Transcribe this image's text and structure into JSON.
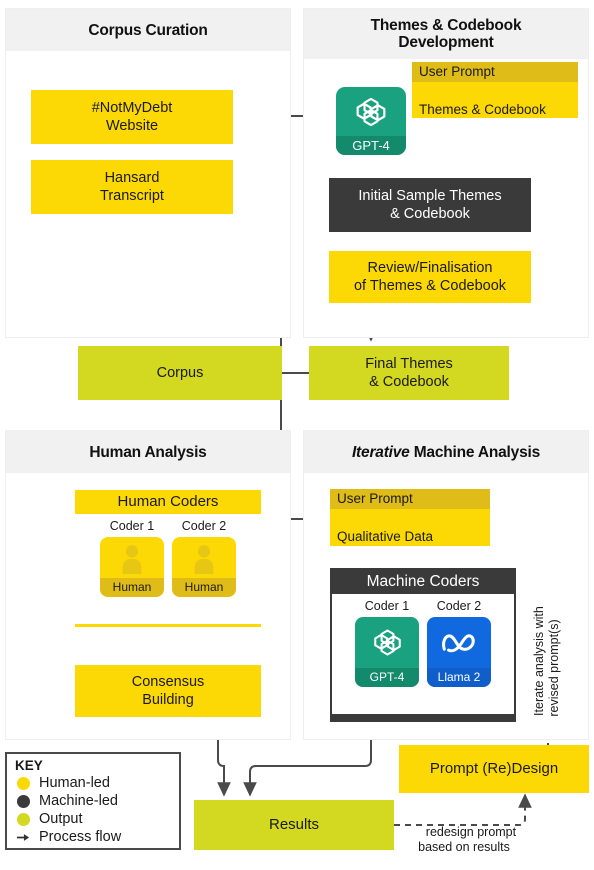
{
  "panels": {
    "corpus_curation": {
      "title": "Corpus Curation"
    },
    "themes": {
      "title_line1": "Themes & Codebook",
      "title_line2": "Development"
    },
    "human_analysis": {
      "title": "Human Analysis"
    },
    "machine_analysis": {
      "title_italic": "Iterative",
      "title_rest": " Machine Analysis"
    }
  },
  "nodes": {
    "notmydebt": "#NotMyDebt\nWebsite",
    "hansard": "Hansard\nTranscript",
    "corpus": "Corpus",
    "initial_sample": "Initial Sample Themes\n& Codebook",
    "review_final": "Review/Finalisation\nof Themes & Codebook",
    "final_themes": "Final Themes\n& Codebook",
    "consensus": "Consensus\nBuilding",
    "results": "Results",
    "prompt_redesign": "Prompt (Re)Design"
  },
  "prompts": {
    "themes_prompt": {
      "header": "User Prompt",
      "body": "Themes & Codebook\nGeneration",
      "terminal_glyph": ">_"
    },
    "analysis_prompt": {
      "header": "User Prompt",
      "body": "Qualitative Data\nAnalysis",
      "terminal_glyph": ">_"
    }
  },
  "gpt_node": {
    "name": "GPT-4",
    "icon": "openai-logo"
  },
  "human_coders": {
    "title": "Human Coders",
    "coders": [
      {
        "label": "Coder 1",
        "name": "Human",
        "icon": "person-icon"
      },
      {
        "label": "Coder 2",
        "name": "Human",
        "icon": "person-icon"
      }
    ]
  },
  "machine_coders": {
    "title": "Machine Coders",
    "coders": [
      {
        "label": "Coder 1",
        "name": "GPT-4",
        "icon": "openai-logo"
      },
      {
        "label": "Coder 2",
        "name": "Llama 2",
        "icon": "meta-logo"
      }
    ]
  },
  "annotations": {
    "iterate": "Iterate analysis with\nrevised prompt(s)",
    "redesign": "redesign prompt\nbased on results"
  },
  "key": {
    "title": "KEY",
    "items": [
      {
        "label": "Human-led",
        "color": "#fcd905",
        "marker": "dot"
      },
      {
        "label": "Machine-led",
        "color": "#3a3a3a",
        "marker": "dot"
      },
      {
        "label": "Output",
        "color": "#d3d820",
        "marker": "dot"
      },
      {
        "label": "Process flow",
        "color": "#4a4a4a",
        "marker": "arrow"
      }
    ]
  },
  "colors": {
    "human_led": "#fcd905",
    "machine_led": "#3a3a3a",
    "output": "#d3d820",
    "gpt_green": "#1aa17f",
    "llama_blue": "#1169e0",
    "prompt_header": "#e0bc18",
    "panel_header": "#f1f1f1",
    "edge": "#4a4a4a"
  }
}
